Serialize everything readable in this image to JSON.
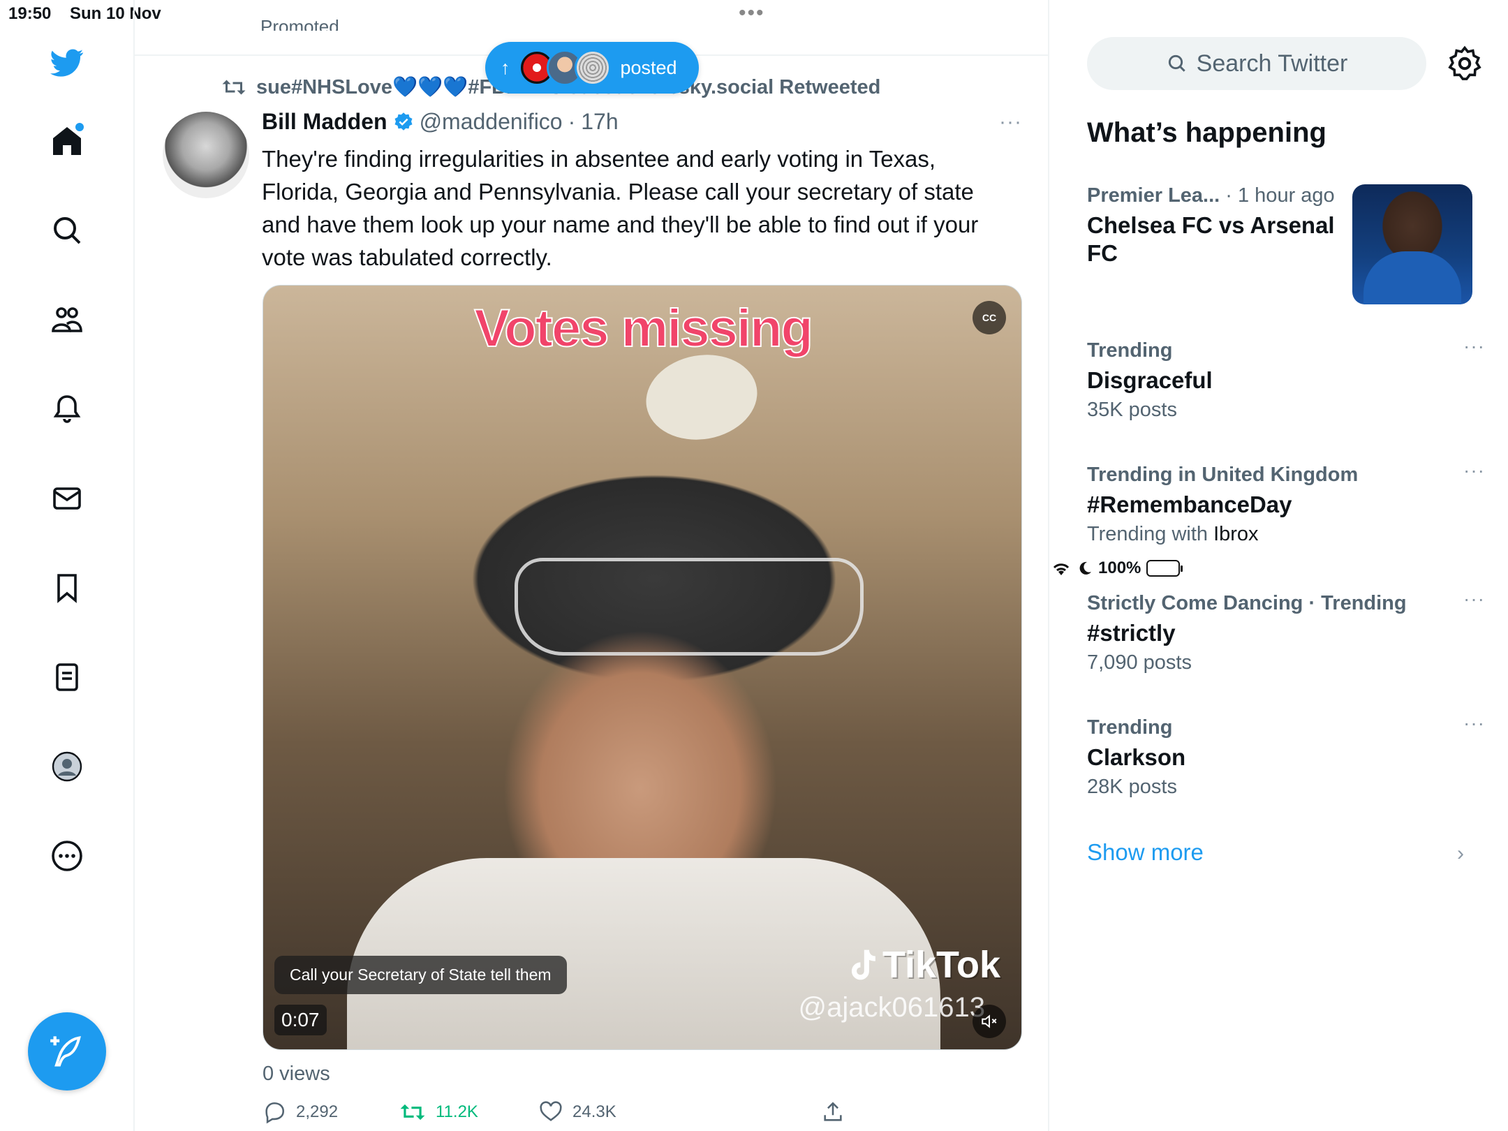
{
  "status_bar": {
    "time": "19:50",
    "date": "Sun 10 Nov",
    "battery": "100%"
  },
  "nav": {
    "items": [
      "twitter-logo",
      "home",
      "explore",
      "communities",
      "notifications",
      "messages",
      "bookmarks",
      "lists",
      "profile",
      "more"
    ],
    "compose_label": "Tweet"
  },
  "feed": {
    "promoted_label": "Promoted",
    "new_posts_pill": {
      "label": "posted",
      "arrow": "↑"
    },
    "tweet": {
      "retweeted_by": "sue#NHSLove💙💙💙#FBPNHS suesue23.bsky.social Retweeted",
      "author_name": "Bill Madden",
      "verified": true,
      "handle": "@maddenifico",
      "separator": "·",
      "time": "17h",
      "more": "···",
      "text": "They're finding irregularities in absentee and early voting in Texas, Florida, Georgia and Pennsylvania. Please call your secretary of state and have them look up your name and they'll be able to find out if your vote was tabulated correctly.",
      "media": {
        "overlay_title": "Votes missing",
        "cc_label": "CC",
        "caption": "Call your Secretary of State tell them",
        "duration": "0:07",
        "watermark": "TikTok",
        "watermark_handle": "@ajack061613"
      },
      "views": "0 views",
      "stats": {
        "replies": "2,292",
        "retweets": "11.2K",
        "likes": "24.3K"
      }
    }
  },
  "sidebar": {
    "search_placeholder": "Search Twitter",
    "whats_happening": "What’s happening",
    "trends": [
      {
        "context": "Premier Lea...",
        "context_extra": "· 1 hour ago",
        "topic": "Chelsea FC vs Arsenal FC",
        "sub": ""
      },
      {
        "context": "Trending",
        "topic": "Disgraceful",
        "sub": "35K posts"
      },
      {
        "context": "Trending in United Kingdom",
        "topic": "#RemembanceDay",
        "sub_prefix": "Trending with ",
        "sub_strong": "Ibrox"
      },
      {
        "context": "Strictly Come Dancing · Trending",
        "topic": "#strictly",
        "sub": "7,090 posts"
      },
      {
        "context": "Trending",
        "topic": "Clarkson",
        "sub": "28K posts"
      }
    ],
    "show_more": "Show more",
    "more_dots": "···",
    "chevron": "›"
  },
  "colors": {
    "accent": "#1d9bf0",
    "retweet_green": "#00ba7c",
    "muted": "#536471"
  }
}
